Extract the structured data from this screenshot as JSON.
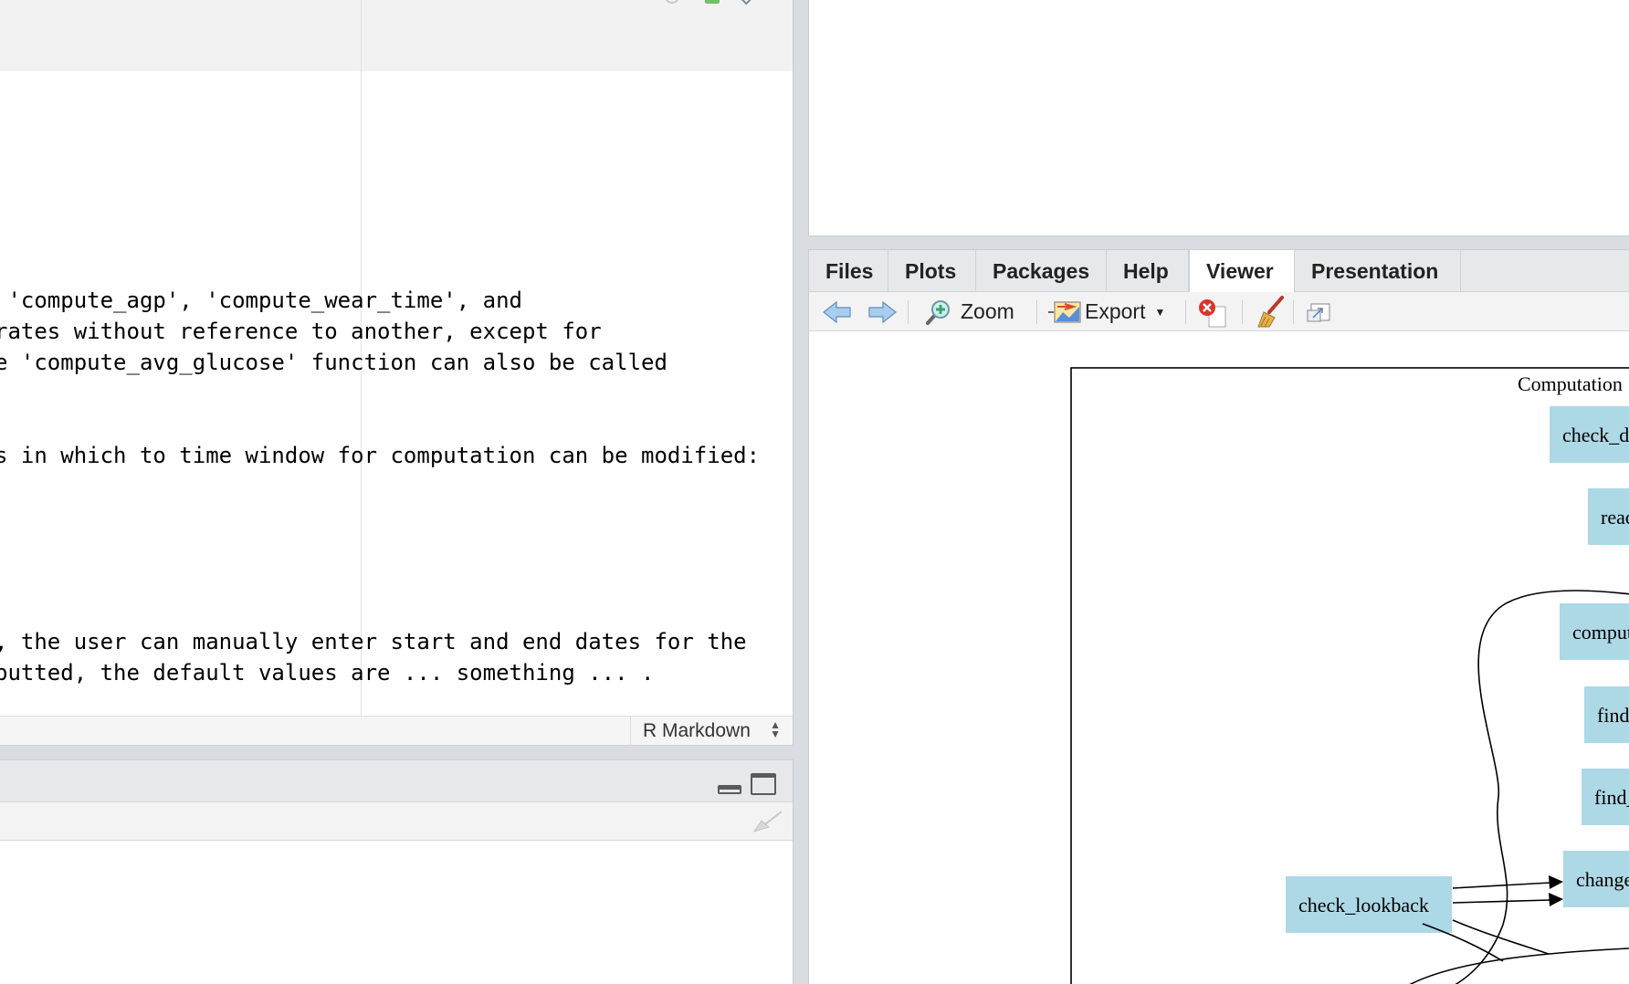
{
  "source_editor": {
    "lines": [
      {
        "text": " 'compute_agp', 'compute_wear_time', and",
        "row": 0
      },
      {
        "text": "rates without reference to another, except for",
        "row": 1
      },
      {
        "text": "e 'compute_avg_glucose' function can also be called",
        "row": 2
      },
      {
        "text": "s in which to time window for computation can be modified:",
        "row": 5
      },
      {
        "text": ", the user can manually enter start and end dates for the",
        "row": 11
      },
      {
        "text": "putted, the default values are ... something ... .",
        "row": 12
      }
    ],
    "doc_type": "R Markdown"
  },
  "viewer": {
    "tabs": [
      {
        "label": "Files",
        "active": false
      },
      {
        "label": "Plots",
        "active": false
      },
      {
        "label": "Packages",
        "active": false
      },
      {
        "label": "Help",
        "active": false
      },
      {
        "label": "Viewer",
        "active": true
      },
      {
        "label": "Presentation",
        "active": false
      }
    ],
    "toolbar": {
      "zoom_label": "Zoom",
      "export_label": "Export"
    },
    "diagram": {
      "title": "Computation",
      "nodes": [
        {
          "label": "check_day"
        },
        {
          "label": "read_"
        },
        {
          "label": "compute"
        },
        {
          "label": "find_c"
        },
        {
          "label": "find_s"
        },
        {
          "label": "change"
        },
        {
          "label": "check_lookback"
        }
      ],
      "node_fill": "#add8e6"
    }
  }
}
